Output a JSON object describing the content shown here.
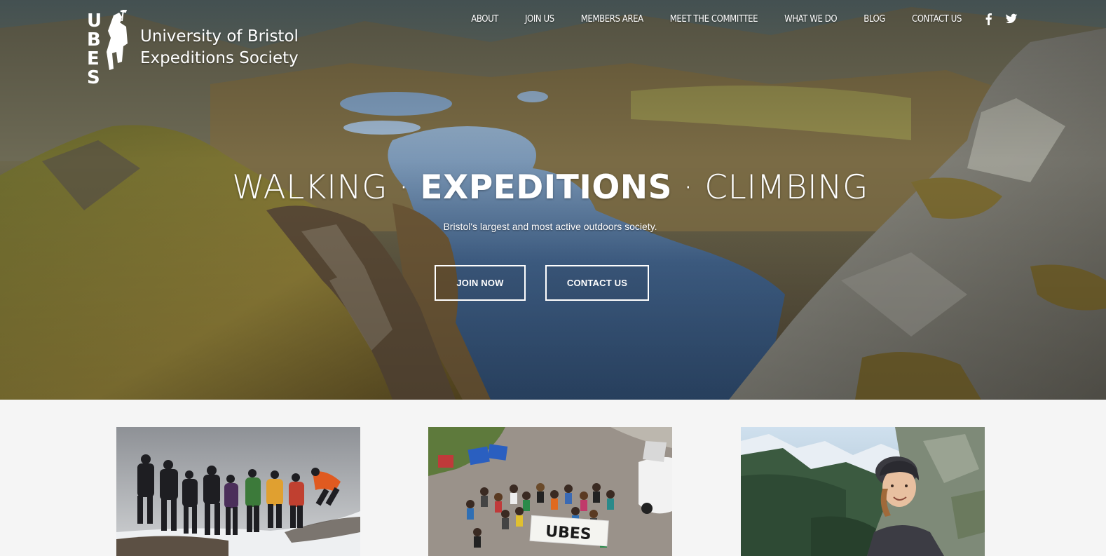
{
  "brand": {
    "mark_letters": [
      "U",
      "B",
      "E",
      "S"
    ],
    "name_line1": "University of Bristol",
    "name_line2": "Expeditions Society"
  },
  "nav": {
    "items": [
      "ABOUT",
      "JOIN US",
      "MEMBERS AREA",
      "MEET THE COMMITTEE",
      "WHAT WE DO",
      "BLOG",
      "CONTACT US"
    ],
    "social": [
      "facebook-icon",
      "twitter-icon"
    ]
  },
  "hero": {
    "headline_part1": "WALKING · ",
    "headline_part2": "EXPEDITIONS",
    "headline_part3": " · CLIMBING",
    "subtitle": "Bristol's largest and most active outdoors society.",
    "primary_button": "JOIN NOW",
    "secondary_button": "CONTACT US"
  },
  "cards": {
    "banner_text": "UBES"
  },
  "colors": {
    "background": "#f5f5f5",
    "text_on_hero": "#ffffff"
  }
}
